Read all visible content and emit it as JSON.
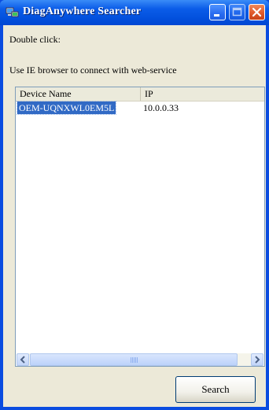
{
  "window": {
    "title": "DiagAnywhere Searcher",
    "icon": "diag-app-icon"
  },
  "titlebar_buttons": [
    {
      "name": "minimize",
      "icon": "minimize-icon"
    },
    {
      "name": "maximize",
      "icon": "maximize-icon"
    },
    {
      "name": "close",
      "icon": "close-icon"
    }
  ],
  "instructions": {
    "line1": "Double click:",
    "line2": "Use IE browser to connect with web-service"
  },
  "device_list": {
    "columns": [
      "Device Name",
      "IP"
    ],
    "rows": [
      {
        "device_name": "OEM-UQNXWL0EM5L",
        "ip": "10.0.0.33",
        "selected": true
      }
    ]
  },
  "scrollbar": {
    "left_icon": "chevron-left-icon",
    "right_icon": "chevron-right-icon"
  },
  "actions": {
    "search_label": "Search"
  },
  "colors": {
    "titlebar": "#0b5ce8",
    "selection": "#316ac5",
    "client_background": "#ece9d8"
  }
}
